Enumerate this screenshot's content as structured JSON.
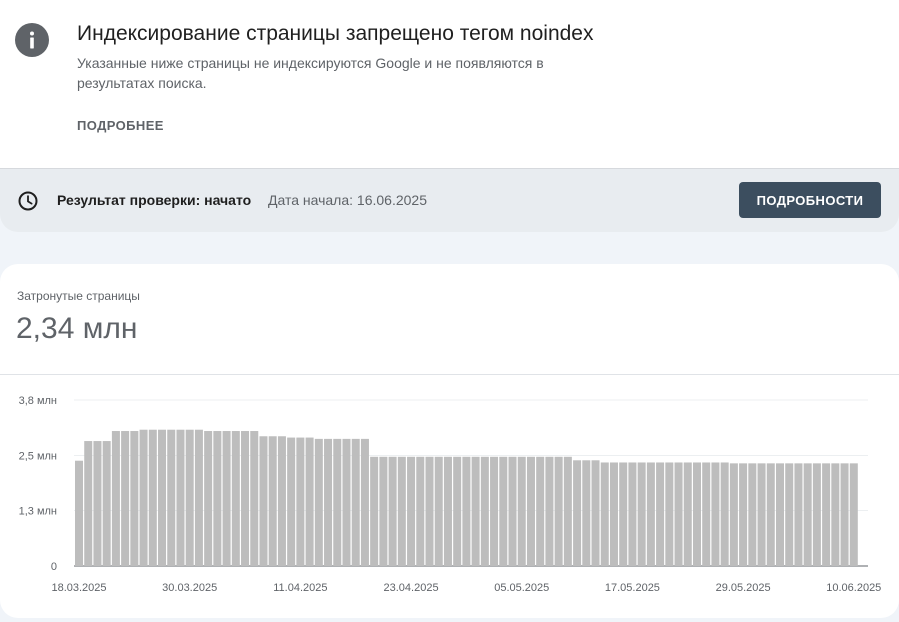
{
  "issue": {
    "icon": "info-icon",
    "title": "Индексирование страницы запрещено тегом noindex",
    "description": "Указанные ниже страницы не индексируются Google и не появляются в результатах поиска.",
    "more_link": "ПОДРОБНЕЕ"
  },
  "validation": {
    "icon": "clock-icon",
    "status": "Результат проверки: начато",
    "start_date": "Дата начала: 16.06.2025",
    "details_button": "ПОДРОБНОСТИ"
  },
  "metric": {
    "label": "Затронутые страницы",
    "value": "2,34 млн"
  },
  "colors": {
    "bar": "#bdbdbd",
    "button": "#3c4e5f",
    "icon": "#5f6368"
  },
  "chart_data": {
    "type": "bar",
    "ylim": [
      0,
      3.8
    ],
    "yticks": [
      {
        "value": 0,
        "label": "0"
      },
      {
        "value": 1.27,
        "label": "1,3 млн"
      },
      {
        "value": 2.53,
        "label": "2,5 млн"
      },
      {
        "value": 3.8,
        "label": "3,8 млн"
      }
    ],
    "grid": true,
    "xtick_labels": [
      "18.03.2025",
      "30.03.2025",
      "11.04.2025",
      "23.04.2025",
      "05.05.2025",
      "17.05.2025",
      "29.05.2025",
      "10.06.2025"
    ],
    "xtick_every": 12,
    "values": [
      2.41,
      2.86,
      2.86,
      2.86,
      3.09,
      3.09,
      3.09,
      3.12,
      3.12,
      3.12,
      3.12,
      3.12,
      3.12,
      3.12,
      3.09,
      3.09,
      3.09,
      3.09,
      3.09,
      3.09,
      2.97,
      2.97,
      2.97,
      2.94,
      2.94,
      2.94,
      2.91,
      2.91,
      2.91,
      2.91,
      2.91,
      2.91,
      2.5,
      2.5,
      2.5,
      2.5,
      2.5,
      2.5,
      2.5,
      2.5,
      2.5,
      2.5,
      2.5,
      2.5,
      2.5,
      2.5,
      2.5,
      2.5,
      2.5,
      2.5,
      2.5,
      2.5,
      2.5,
      2.5,
      2.42,
      2.42,
      2.42,
      2.37,
      2.37,
      2.37,
      2.37,
      2.37,
      2.37,
      2.37,
      2.37,
      2.37,
      2.37,
      2.37,
      2.37,
      2.37,
      2.37,
      2.35,
      2.35,
      2.35,
      2.35,
      2.35,
      2.35,
      2.35,
      2.35,
      2.35,
      2.35,
      2.35,
      2.35,
      2.35,
      2.35
    ]
  }
}
